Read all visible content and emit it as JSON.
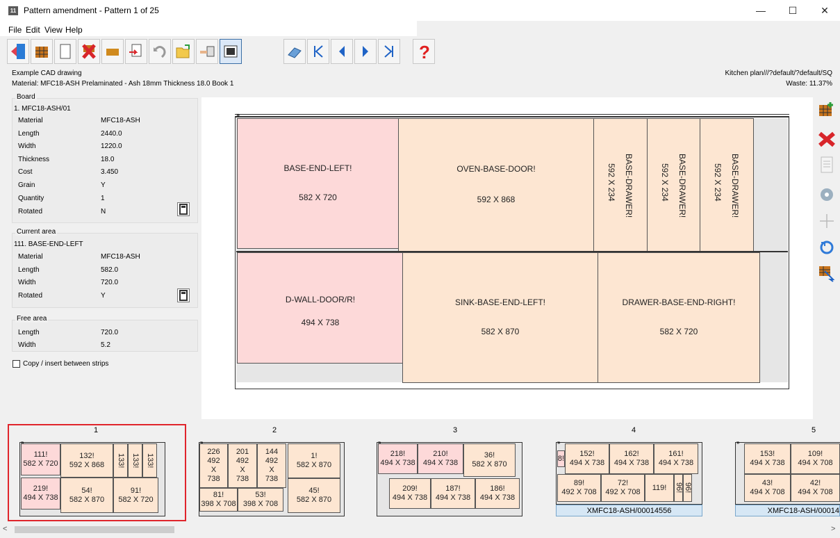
{
  "window": {
    "title": "Pattern amendment - Pattern 1 of 25",
    "icon_text": "11",
    "minimize": "—",
    "maximize": "☐",
    "close": "✕"
  },
  "menu": [
    "File",
    "Edit",
    "View",
    "Help"
  ],
  "info": {
    "drawing": "Example CAD drawing",
    "material_line": "Material: MFC18-ASH Prelaminated - Ash 18mm Thickness 18.0 Book 1",
    "plan": "Kitchen plan///?default/?default/SQ",
    "waste": "Waste: 11.37%"
  },
  "board": {
    "title": "Board",
    "id": "1. MFC18-ASH/01",
    "rows": [
      {
        "label": "Material",
        "value": "MFC18-ASH"
      },
      {
        "label": "Length",
        "value": "2440.0"
      },
      {
        "label": "Width",
        "value": "1220.0"
      },
      {
        "label": "Thickness",
        "value": "18.0"
      },
      {
        "label": "Cost",
        "value": "3.450"
      },
      {
        "label": "Grain",
        "value": "Y"
      },
      {
        "label": "Quantity",
        "value": "1"
      },
      {
        "label": "Rotated",
        "value": "N"
      }
    ]
  },
  "current_area": {
    "title": "Current area",
    "id": "111. BASE-END-LEFT",
    "rows": [
      {
        "label": "Material",
        "value": "MFC18-ASH"
      },
      {
        "label": "Length",
        "value": "582.0"
      },
      {
        "label": "Width",
        "value": "720.0"
      },
      {
        "label": "Rotated",
        "value": "Y"
      }
    ]
  },
  "free_area": {
    "title": "Free area",
    "rows": [
      {
        "label": "Length",
        "value": "720.0"
      },
      {
        "label": "Width",
        "value": "5.2"
      }
    ]
  },
  "copy_checkbox": {
    "label": "Copy / insert between strips",
    "checked": false
  },
  "pattern": {
    "pieces": [
      {
        "name": "BASE-END-LEFT!",
        "size": "582 X 720",
        "color": "pink"
      },
      {
        "name": "OVEN-BASE-DOOR!",
        "size": "592 X 868",
        "color": "peach"
      },
      {
        "name": "BASE-DRAWER!",
        "size": "592 X 234",
        "color": "peach"
      },
      {
        "name": "BASE-DRAWER!",
        "size": "592 X 234",
        "color": "peach"
      },
      {
        "name": "BASE-DRAWER!",
        "size": "592 X 234",
        "color": "peach"
      },
      {
        "name": "D-WALL-DOOR/R!",
        "size": "494 X 738",
        "color": "pink"
      },
      {
        "name": "SINK-BASE-END-LEFT!",
        "size": "582 X 870",
        "color": "peach"
      },
      {
        "name": "DRAWER-BASE-END-RIGHT!",
        "size": "582 X 720",
        "color": "peach"
      }
    ]
  },
  "thumbnails": {
    "numbers": [
      "1",
      "2",
      "3",
      "4",
      "5"
    ],
    "t1": [
      "111!",
      "582 X 720",
      "132!",
      "592 X 868",
      "133!",
      "133!",
      "133!",
      "219!",
      "494 X 738",
      "54!",
      "582 X 870",
      "91!",
      "582 X 720"
    ],
    "t2": [
      "226",
      "492",
      "X",
      "738",
      "201",
      "492",
      "X",
      "738",
      "144",
      "492",
      "X",
      "738",
      "1!",
      "582 X 870",
      "81!",
      "398 X 708",
      "53!",
      "398 X 708",
      "45!",
      "582 X 870"
    ],
    "t3": [
      "218!",
      "494 X 738",
      "210!",
      "494 X 738",
      "36!",
      "582 X 870",
      "209!",
      "494 X 738",
      "187!",
      "494 X 738",
      "186!",
      "494 X 738"
    ],
    "t4": [
      "8!",
      "152!",
      "494 X 738",
      "162!",
      "494 X 738",
      "161!",
      "494 X 738",
      "89!",
      "492 X 708",
      "72!",
      "492 X 708",
      "119!",
      "96!",
      "96!",
      "XMFC18-ASH/00014556"
    ],
    "t5": [
      "153!",
      "494 X 738",
      "109!",
      "494 X 708",
      "43!",
      "494 X 708",
      "42!",
      "494 X 708",
      "XMFC18-ASH/00014"
    ]
  },
  "colors": {
    "pink": "#fdd9d9",
    "peach": "#fde6d2",
    "selected_border": "#e0242b",
    "offcut": "#d6e7f5"
  }
}
